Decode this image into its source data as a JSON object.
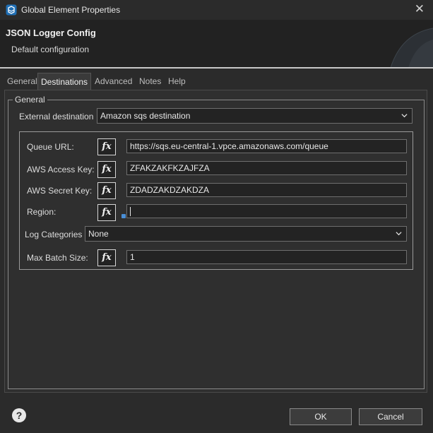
{
  "window": {
    "title": "Global Element Properties",
    "close_glyph": "✕",
    "app_icon": "studio-icon"
  },
  "header": {
    "title": "JSON Logger Config",
    "subtitle": "Default configuration"
  },
  "tabs": [
    {
      "label": "General"
    },
    {
      "label": "Destinations",
      "active": true
    },
    {
      "label": "Advanced"
    },
    {
      "label": "Notes"
    },
    {
      "label": "Help"
    }
  ],
  "general_group": {
    "legend": "General",
    "external_destination": {
      "label": "External destination",
      "value": "Amazon sqs destination"
    }
  },
  "sqs": {
    "queue_url": {
      "label": "Queue URL:",
      "value": "https://sqs.eu-central-1.vpce.amazonaws.com/queue"
    },
    "access_key": {
      "label": "AWS Access Key:",
      "value": "ZFAKZAKFKZAJFZA"
    },
    "secret_key": {
      "label": "AWS Secret Key:",
      "value": "ZDADZAKDZAKDZA"
    },
    "region": {
      "label": "Region:",
      "value": ""
    },
    "log_categories": {
      "label": "Log Categories",
      "value": "None"
    },
    "max_batch_size": {
      "label": "Max Batch Size:",
      "value": "1"
    },
    "fx_label": "fx"
  },
  "footer": {
    "help_glyph": "?",
    "ok_label": "OK",
    "cancel_label": "Cancel"
  },
  "colors": {
    "background": "#2b2b2b",
    "header_bg": "#222222",
    "field_bg": "#232323",
    "info_marker": "#4a8fd6"
  }
}
